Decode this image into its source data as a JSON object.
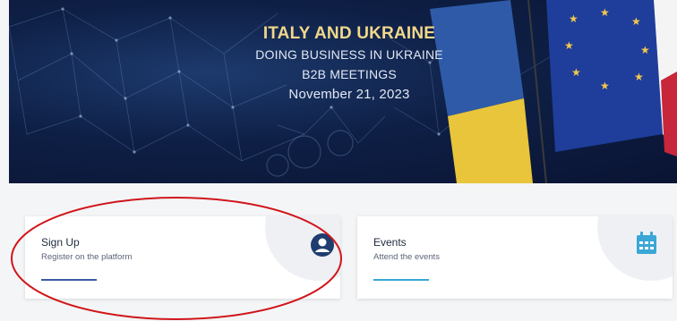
{
  "hero": {
    "title": "ITALY AND UKRAINE",
    "line1": "DOING BUSINESS IN UKRAINE",
    "line2": "B2B MEETINGS",
    "date": "November 21, 2023",
    "colors": {
      "title": "#f1d88a",
      "ukraine_blue": "#2f5aa8",
      "ukraine_yellow": "#e8c53a",
      "eu_blue": "#1f3d9a",
      "eu_star": "#f2c94c"
    }
  },
  "cards": [
    {
      "title": "Sign Up",
      "subtitle": "Register on the platform",
      "icon": "user-circle-icon",
      "accent": "#1f3d6e"
    },
    {
      "title": "Events",
      "subtitle": "Attend the events",
      "icon": "calendar-icon",
      "accent": "#3aa7d6"
    }
  ],
  "annotation": {
    "shape": "ellipse",
    "color": "#d0161b"
  }
}
